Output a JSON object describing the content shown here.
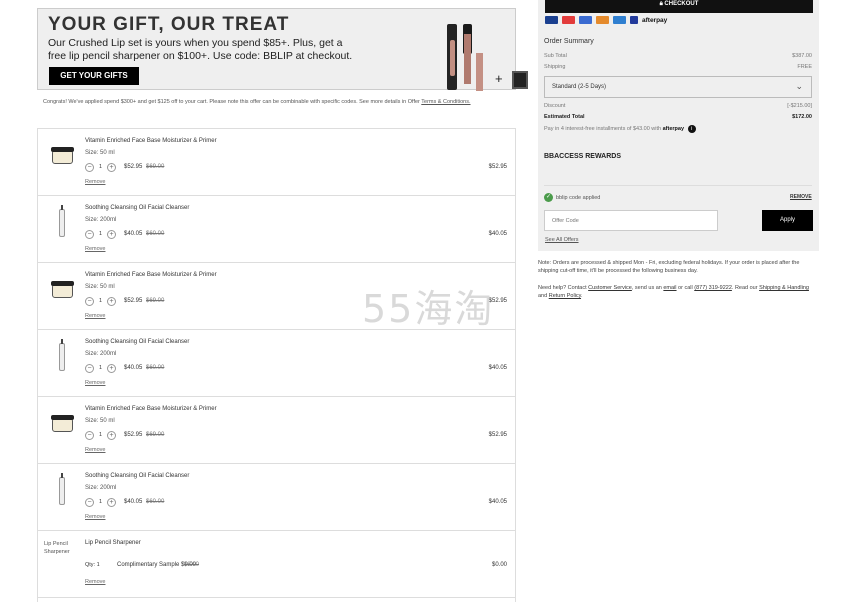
{
  "banner": {
    "headline": "YOUR GIFT, OUR TREAT",
    "line1": "Our Crushed Lip set is yours when you spend $85+. Plus, get a",
    "line2": "free lip pencil sharpener on $100+.  Use code: BBLIP at checkout.",
    "button": "GET YOUR GIFTS"
  },
  "congrats": {
    "text": "Congrats! We've applied spend $300+ and get $125 off to your cart. Please note this offer can be combinable with specific codes. See more details in Offer ",
    "link": "Terms & Conditions."
  },
  "cart": {
    "items": [
      {
        "name": "Vitamin Enriched Face Base Moisturizer & Primer",
        "size": "Size: 50 ml",
        "qty": "1",
        "price": "$52.95",
        "was": "$69.00",
        "total": "$52.95",
        "remove": "Remove",
        "thumb": "jar"
      },
      {
        "name": "Soothing Cleansing Oil Facial Cleanser",
        "size": "Size: 200ml",
        "qty": "1",
        "price": "$40.05",
        "was": "$60.00",
        "total": "$40.05",
        "remove": "Remove",
        "thumb": "bottle"
      },
      {
        "name": "Vitamin Enriched Face Base Moisturizer & Primer",
        "size": "Size: 50 ml",
        "qty": "1",
        "price": "$52.95",
        "was": "$69.00",
        "total": "$52.95",
        "remove": "Remove",
        "thumb": "jar"
      },
      {
        "name": "Soothing Cleansing Oil Facial Cleanser",
        "size": "Size: 200ml",
        "qty": "1",
        "price": "$40.05",
        "was": "$60.00",
        "total": "$40.05",
        "remove": "Remove",
        "thumb": "bottle"
      },
      {
        "name": "Vitamin Enriched Face Base Moisturizer & Primer",
        "size": "Size: 50 ml",
        "qty": "1",
        "price": "$52.95",
        "was": "$69.00",
        "total": "$52.95",
        "remove": "Remove",
        "thumb": "jar"
      },
      {
        "name": "Soothing Cleansing Oil Facial Cleanser",
        "size": "Size: 200ml",
        "qty": "1",
        "price": "$40.05",
        "was": "$60.00",
        "total": "$40.05",
        "remove": "Remove",
        "thumb": "bottle"
      }
    ],
    "sharpener": {
      "alt": "Lip Pencil Sharpener",
      "name": "Lip Pencil Sharpener",
      "qty": "Qty: 1",
      "price": "Complimentary Sample $0.00",
      "was": "$8.00",
      "total": "$0.00",
      "remove": "Remove"
    }
  },
  "summary": {
    "checkout": "CHECKOUT",
    "afterpay": "afterpay",
    "title": "Order Summary",
    "subtotal_label": "Sub Total",
    "subtotal": "$387.00",
    "shipping_label": "Shipping",
    "shipping": "FREE",
    "shipping_option": "Standard (2-5 Days)",
    "discount_label": "Discount",
    "discount": "[-$215.00]",
    "estimated_label": "Estimated Total",
    "estimated": "$172.00",
    "installments": "Pay in 4 interest-free installments of $43.00 with",
    "rewards": "BBACCESS REWARDS",
    "code_applied": "bblip code applied",
    "remove": "REMOVE",
    "offer_placeholder": "Offer Code",
    "apply": "Apply",
    "see_all": "See All Offers"
  },
  "note": "Note: Orders are processed & shipped Mon - Fri, excluding federal holidays. If your order is placed after the shipping cut-off time, it'll be processed the following business day.",
  "help": {
    "prefix": "Need help? Contact ",
    "customer_service": "Customer Service",
    "mid1": ", send us an ",
    "email": "email",
    "mid2": " or call ",
    "phone": "(877) 319-9222",
    "mid3": ". Read our ",
    "shipping": "Shipping & Handling",
    "mid4": " and ",
    "policy": "Return Policy",
    "end": "."
  },
  "watermark": "55海淘",
  "colors": {
    "accent": "#000000",
    "panel": "#efefef",
    "success": "#4b9b4b"
  }
}
